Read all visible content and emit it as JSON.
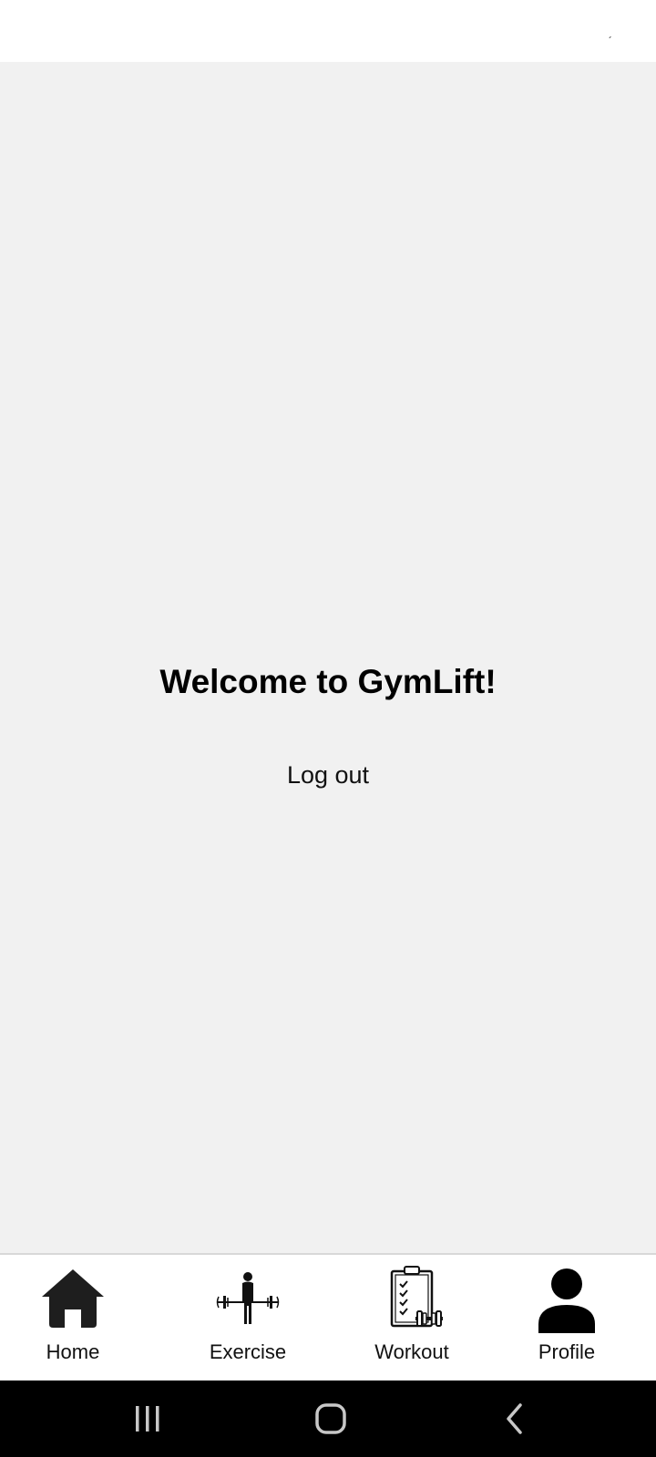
{
  "status_bar": {
    "mark": "´"
  },
  "main": {
    "welcome_title": "Welcome to GymLift!",
    "logout_label": "Log out"
  },
  "bottom_nav": {
    "items": [
      {
        "label": "Home",
        "icon": "home-icon"
      },
      {
        "label": "Exercise",
        "icon": "barbell-lifter-icon"
      },
      {
        "label": "Workout",
        "icon": "clipboard-dumbbell-icon"
      },
      {
        "label": "Profile",
        "icon": "person-icon"
      }
    ]
  },
  "system_nav": {
    "buttons": [
      "recent-apps-icon",
      "home-circle-icon",
      "back-icon"
    ]
  },
  "colors": {
    "background": "#f1f1f1",
    "surface": "#ffffff",
    "text": "#000000",
    "system_bar": "#000000"
  }
}
